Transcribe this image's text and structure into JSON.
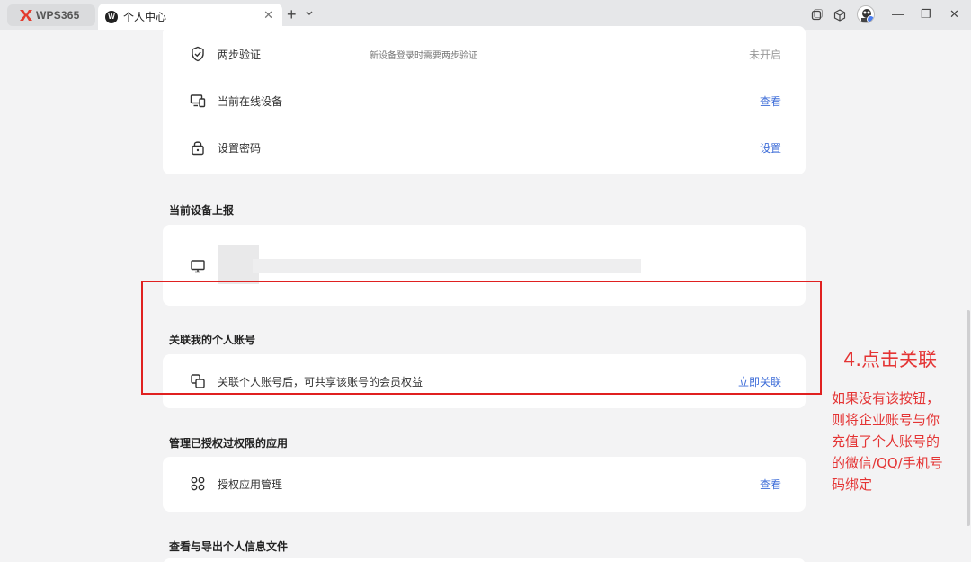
{
  "browser": {
    "app_tab": {
      "label": "WPS365"
    },
    "active_tab": {
      "label": "个人中心",
      "close": "✕"
    },
    "new_tab": "+",
    "tab_menu": "⌄",
    "window_controls": {
      "minimize": "—",
      "restore": "❐",
      "close": "✕"
    }
  },
  "security": {
    "rows": [
      {
        "label": "两步验证",
        "desc": "新设备登录时需要两步验证",
        "status": "未开启",
        "icon": "shield-icon"
      },
      {
        "label": "当前在线设备",
        "action": "查看",
        "icon": "devices-icon"
      },
      {
        "label": "设置密码",
        "action": "设置",
        "icon": "lock-icon"
      }
    ]
  },
  "device_report": {
    "title": "当前设备上报",
    "icon": "monitor-icon"
  },
  "link_account": {
    "title": "关联我的个人账号",
    "label": "关联个人账号后，可共享该账号的会员权益",
    "action": "立即关联",
    "icon": "link-account-icon"
  },
  "authorized_apps": {
    "title": "管理已授权过权限的应用",
    "label": "授权应用管理",
    "action": "查看",
    "icon": "apps-grid-icon"
  },
  "export_info": {
    "title": "查看与导出个人信息文件"
  },
  "annotation": {
    "title": "4.点击关联",
    "text": "如果没有该按钮，\n则将企业账号与你\n充值了个人账号的\n的微信/QQ/手机号\n码绑定"
  },
  "colors": {
    "link": "#3e6dd8",
    "annotation": "#e43434",
    "background": "#f3f3f4"
  }
}
